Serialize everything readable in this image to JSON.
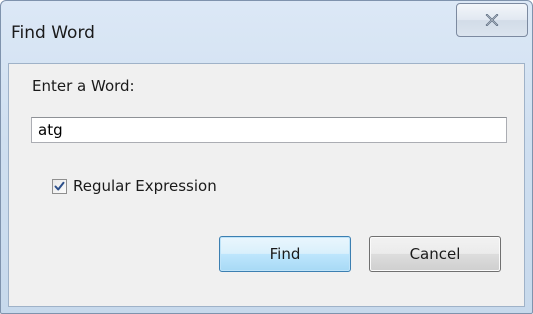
{
  "window": {
    "title": "Find Word"
  },
  "titlebar": {
    "close_icon": "close-x-icon"
  },
  "form": {
    "prompt_label": "Enter a Word:",
    "word_value": "atg",
    "regex_checkbox": {
      "label": "Regular Expression",
      "checked": true,
      "icon": "checkmark-icon"
    }
  },
  "buttons": {
    "find_label": "Find",
    "cancel_label": "Cancel"
  },
  "colors": {
    "title_gradient": "#dce8f6",
    "client_bg": "#f0f0f0",
    "default_button_border": "#3c7fb1",
    "checkmark": "#2c4f8a"
  }
}
